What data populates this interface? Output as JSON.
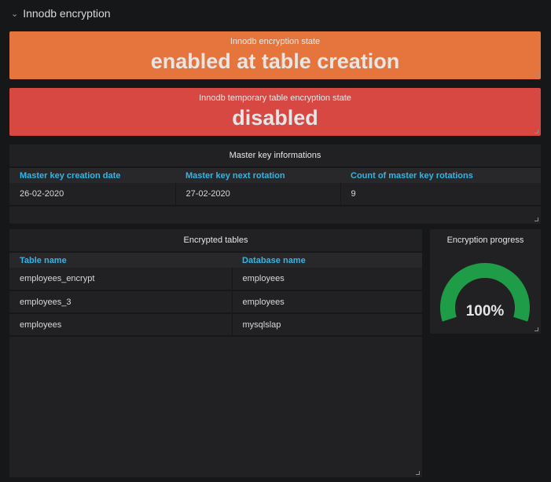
{
  "row": {
    "title": "Innodb encryption",
    "icon": "chevron-down-icon"
  },
  "encryption_state": {
    "title": "Innodb encryption state",
    "value": "enabled at table creation",
    "color": "#e5753c"
  },
  "temp_state": {
    "title": "Innodb temporary table encryption state",
    "value": "disabled",
    "color": "#d84843"
  },
  "master_key": {
    "title": "Master key informations",
    "columns": [
      "Master key creation date",
      "Master key next rotation",
      "Count of master key rotations"
    ],
    "rows": [
      [
        "26-02-2020",
        "27-02-2020",
        "9"
      ]
    ]
  },
  "encrypted_tables": {
    "title": "Encrypted tables",
    "columns": [
      "Table name",
      "Database name"
    ],
    "rows": [
      [
        "employees_encrypt",
        "employees"
      ],
      [
        "employees_3",
        "employees"
      ],
      [
        "employees",
        "mysqlslap"
      ]
    ]
  },
  "progress": {
    "title": "Encryption progress",
    "value": "100%",
    "percent": 100,
    "color": "#1f9c47"
  }
}
